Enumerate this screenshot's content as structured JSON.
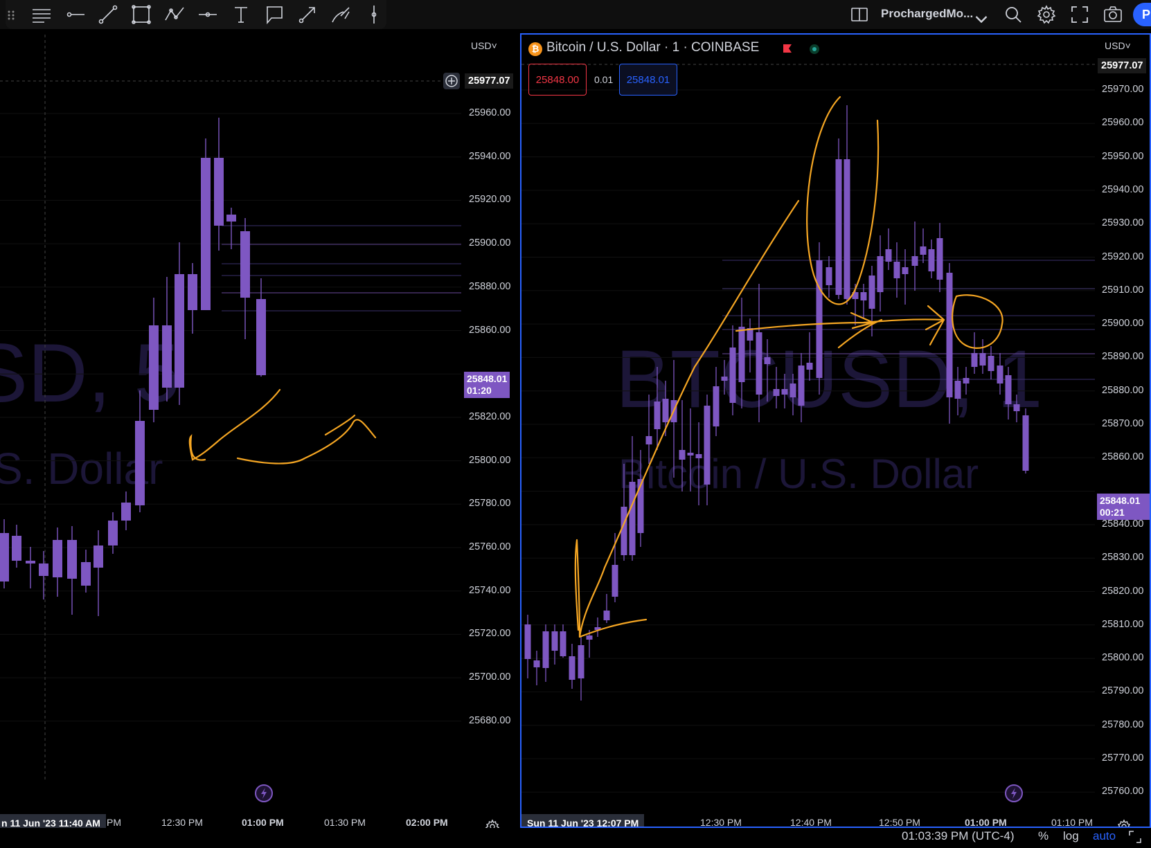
{
  "toolbar": {
    "layout_name": "ProchargedMo...",
    "publish_label": "P",
    "tools": [
      "favorites-grip-icon",
      "horizontal-lines-icon",
      "horizontal-ray-icon",
      "trend-line-icon",
      "rectangle-icon",
      "path-icon",
      "horizontal-line-icon",
      "text-tool-icon",
      "callout-icon",
      "arrow-tool-icon",
      "brush-icon",
      "vertical-line-icon"
    ]
  },
  "left_pane": {
    "currency": "USD",
    "watermark_symbol": "SD, 5",
    "watermark_desc": "S. Dollar",
    "y_labels": [
      "25960.00",
      "25940.00",
      "25920.00",
      "25900.00",
      "25880.00",
      "25860.00",
      "25820.00",
      "25800.00",
      "25780.00",
      "25760.00",
      "25740.00",
      "25720.00",
      "25700.00",
      "25680.00"
    ],
    "top_tag": "25977.07",
    "last_price": "25848.01",
    "countdown": "01:20",
    "x_labels": [
      "PM",
      "12:30 PM",
      "01:00 PM",
      "01:30 PM",
      "02:00 PM"
    ],
    "date_tag": "n 11 Jun '23   11:40 AM"
  },
  "right_pane": {
    "currency": "USD",
    "title": "Bitcoin / U.S. Dollar · 1 · COINBASE",
    "btc_glyph": "₿",
    "sell_price": "25848.00",
    "spread": "0.01",
    "buy_price": "25848.01",
    "watermark_symbol": "BTCUSD, 1",
    "watermark_desc": "Bitcoin / U.S. Dollar",
    "y_labels": [
      "25970.00",
      "25960.00",
      "25950.00",
      "25940.00",
      "25930.00",
      "25920.00",
      "25910.00",
      "25900.00",
      "25890.00",
      "25880.00",
      "25870.00",
      "25860.00",
      "25840.00",
      "25830.00",
      "25820.00",
      "25810.00",
      "25800.00",
      "25790.00",
      "25780.00",
      "25770.00",
      "25760.00"
    ],
    "top_tag": "25977.07",
    "last_price": "25848.01",
    "countdown": "00:21",
    "x_labels": [
      "12:30 PM",
      "12:40 PM",
      "12:50 PM",
      "01:00 PM",
      "01:10 PM"
    ],
    "date_tag": "Sun 11 Jun '23    12:07 PM"
  },
  "status": {
    "time": "01:03:39 PM (UTC-4)",
    "percent": "%",
    "log": "log",
    "auto": "auto"
  },
  "colors": {
    "candle": "#7e57c2",
    "drawing": "#f5a623",
    "accent": "#2962ff",
    "sell": "#f23645",
    "live": "#26a69a"
  }
}
